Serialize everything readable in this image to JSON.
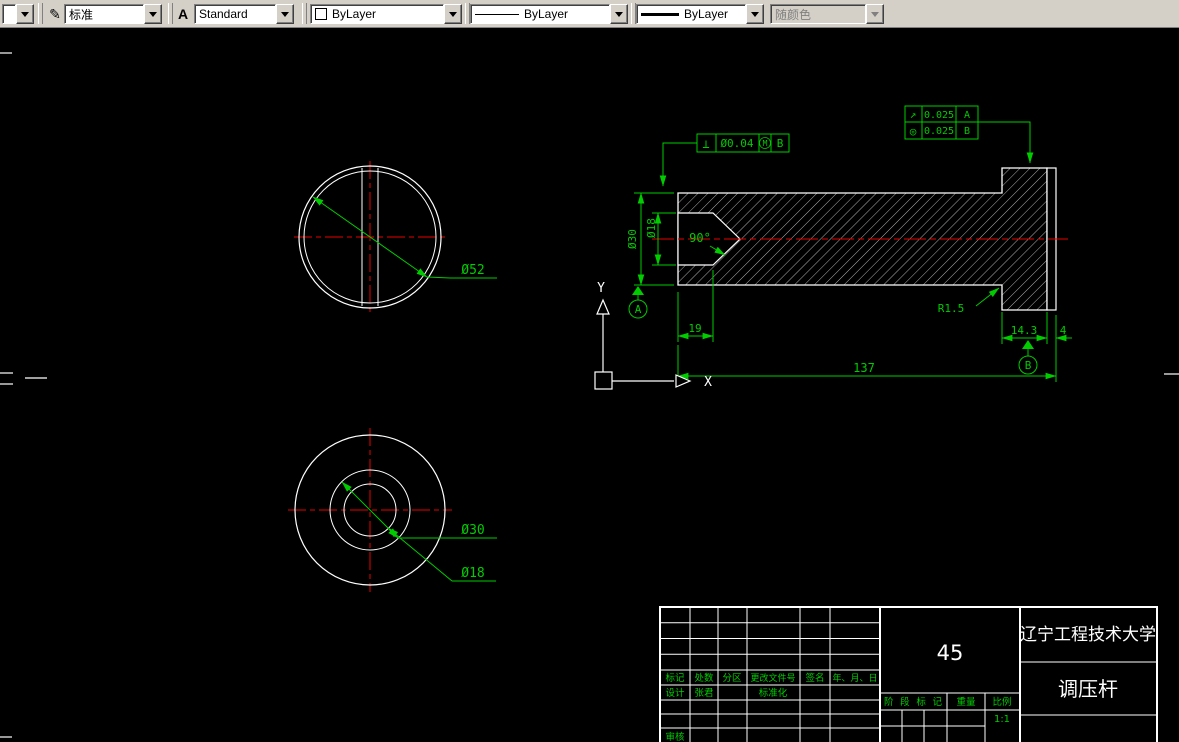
{
  "icons": {
    "chevron_down": "▼",
    "pencil": "✎",
    "letter_a": "A"
  },
  "toolbar": {
    "mini_combo_value": "",
    "dim_style_value": "标准",
    "text_style_value": "Standard",
    "color_value": "ByLayer",
    "linetype_value": "ByLayer",
    "lineweight_value": "ByLayer",
    "plot_style_value": "随颜色"
  },
  "drawing": {
    "top_view": {
      "diameter_label": "Ø52"
    },
    "bottom_view": {
      "outer_label": "Ø30",
      "inner_label": "Ø18"
    },
    "section_view": {
      "dia_outer": "Ø30",
      "dia_hole": "Ø18",
      "cone_angle": "90°",
      "hole_depth": "19",
      "total_length": "137",
      "flange_width": "14.3",
      "end_width": "4",
      "fillet_radius": "R1.5"
    },
    "fcf_perpendicular": {
      "symbol": "⊥",
      "tolerance": "Ø0.04",
      "modifier": "M",
      "datum": "B"
    },
    "fcf_runout": {
      "symbol": "↗",
      "tolerance": "0.025",
      "datum": "A"
    },
    "fcf_concentricity": {
      "symbol": "◎",
      "tolerance": "0.025",
      "datum": "B"
    },
    "datum_a": "A",
    "datum_b": "B",
    "ucs": {
      "x_label": "X",
      "y_label": "Y"
    }
  },
  "title_block": {
    "university": "辽宁工程技术大学",
    "part_name": "调压杆",
    "material": "45",
    "scale_value": "1:1",
    "headers": {
      "mark": "标记",
      "count": "处数",
      "zone": "分区",
      "change_doc": "更改文件号",
      "signature": "签名",
      "date": "年、月、日"
    },
    "design_label": "设计",
    "designer_name": "张君",
    "standardization_label": "标准化",
    "stage_label": "阶段标记",
    "weight_label": "重量",
    "scale_label": "比例",
    "review_label": "审核"
  }
}
